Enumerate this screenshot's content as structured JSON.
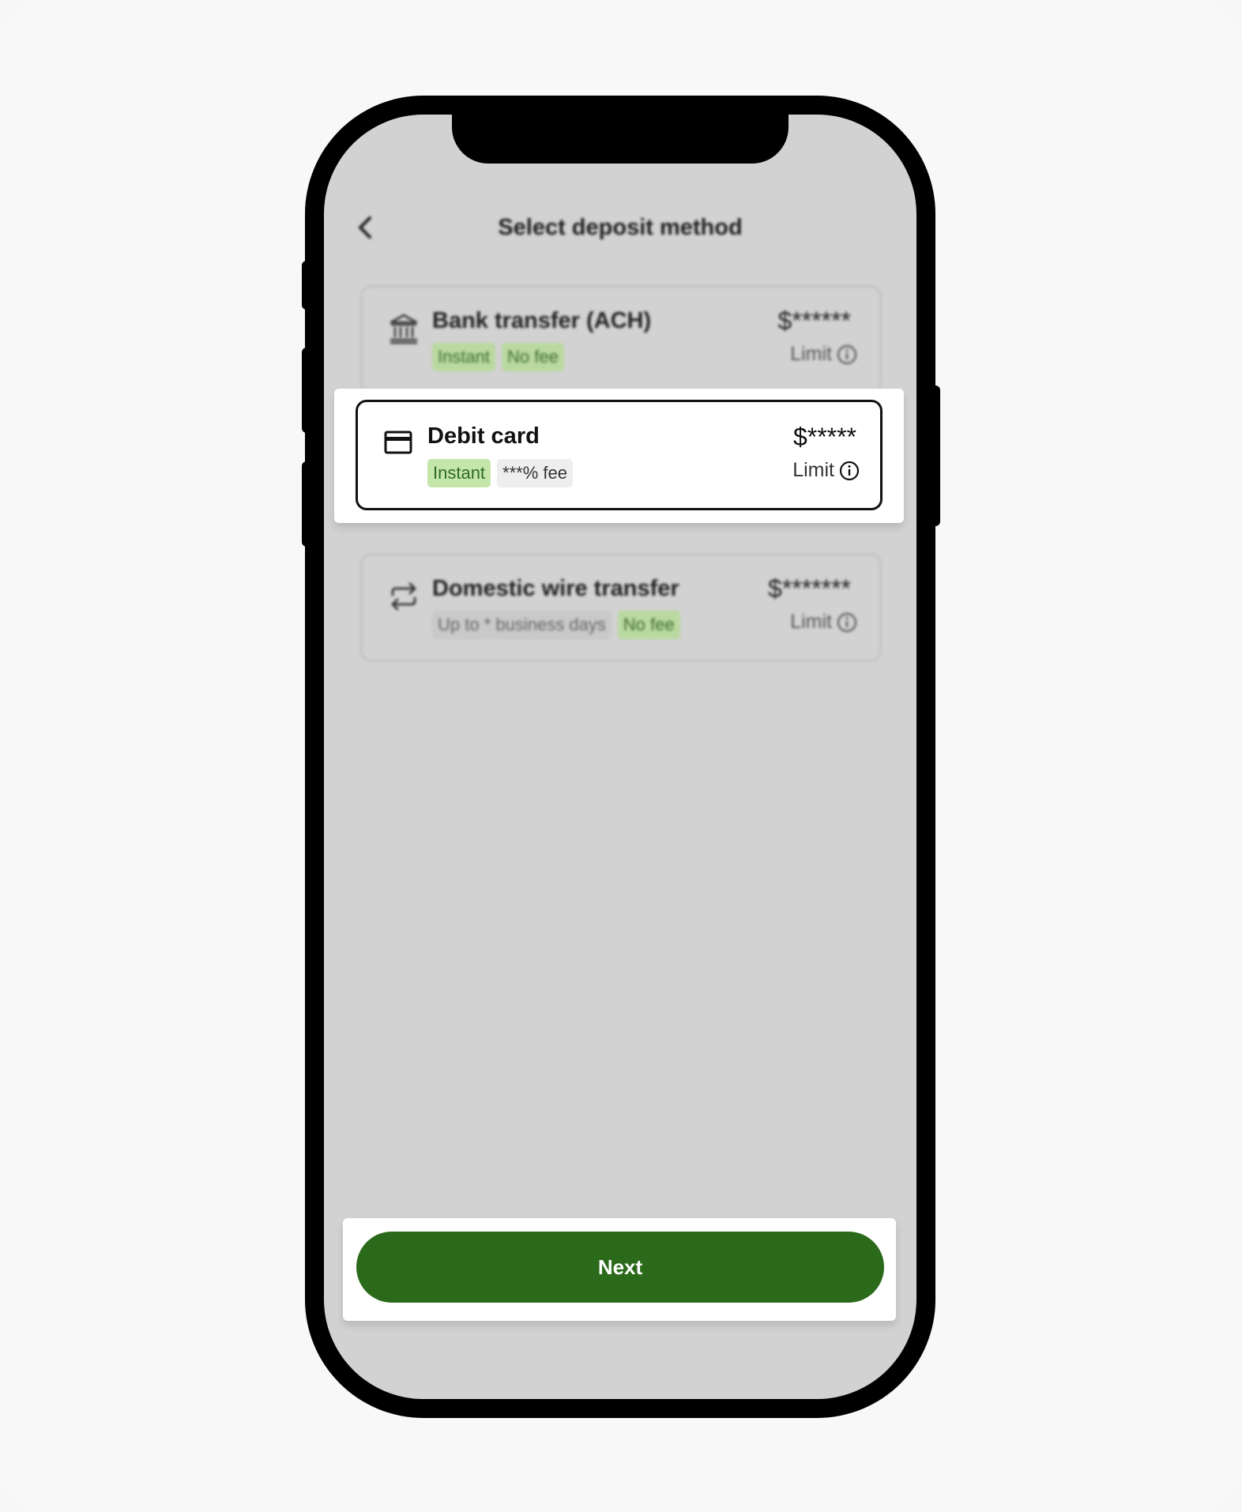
{
  "header": {
    "title": "Select deposit method",
    "back_icon": "chevron-left-icon"
  },
  "methods": [
    {
      "name": "Bank transfer (ACH)",
      "icon": "bank-icon",
      "tags": [
        {
          "label": "Instant",
          "style": "green"
        },
        {
          "label": "No fee",
          "style": "green"
        }
      ],
      "amount": "$******",
      "limit_label": "Limit"
    },
    {
      "name": "Debit card",
      "icon": "credit-card-icon",
      "selected": true,
      "tags": [
        {
          "label": "Instant",
          "style": "green"
        },
        {
          "label": "***% fee",
          "style": "grey"
        }
      ],
      "amount": "$*****",
      "limit_label": "Limit"
    },
    {
      "name": "Domestic wire transfer",
      "icon": "transfer-arrows-icon",
      "tags": [
        {
          "label": "Up to * business days",
          "style": "grey"
        },
        {
          "label": "No fee",
          "style": "green"
        }
      ],
      "amount": "$*******",
      "limit_label": "Limit"
    }
  ],
  "footer": {
    "next_label": "Next"
  },
  "colors": {
    "primary": "#2b6a1a",
    "tag_green": "#c4e6ab",
    "tag_green_text": "#2e6b22",
    "screen_dim": "#d2d2d2"
  }
}
